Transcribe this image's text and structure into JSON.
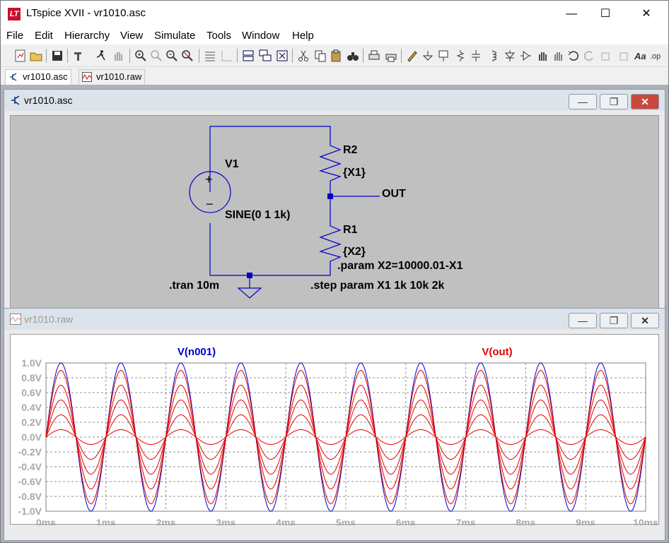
{
  "app": {
    "title": "LTspice XVII - vr1010.asc",
    "icon_name": "ltspice-logo-icon",
    "icon_text": "LT",
    "minimize": "—",
    "maximize": "☐",
    "close": "✕"
  },
  "menu": [
    "File",
    "Edit",
    "Hierarchy",
    "View",
    "Simulate",
    "Tools",
    "Window",
    "Help"
  ],
  "tabs": [
    {
      "label": "vr1010.asc",
      "icon": "schematic-icon",
      "active": true
    },
    {
      "label": "vr1010.raw",
      "icon": "waveform-icon",
      "active": false
    }
  ],
  "schematic": {
    "title": "vr1010.asc",
    "labels": {
      "v1": "V1",
      "v1_value": "SINE(0 1 1k)",
      "r2": "R2",
      "r2_value": "{X1}",
      "r1": "R1",
      "r1_value": "{X2}",
      "out": "OUT",
      "tran": ".tran 10m",
      "param": ".param X2=10000.01-X1",
      "step": ".step param X1 1k 10k 2k"
    },
    "colors": {
      "wire": "#0000c8",
      "background": "#c0c0c0"
    }
  },
  "waveform": {
    "title": "vr1010.raw",
    "trace_labels": {
      "vin": "V(n001)",
      "vout": "V(out)"
    },
    "colors": {
      "vin": "#0000c8",
      "vout": "#e00000",
      "grid": "#808080",
      "axis_text": "#a0a0a0"
    }
  },
  "chart_data": {
    "type": "line",
    "x_unit": "ms",
    "xlim": [
      0,
      10
    ],
    "ylim": [
      -1.0,
      1.0
    ],
    "x_ticks": [
      "0ms",
      "1ms",
      "2ms",
      "3ms",
      "4ms",
      "5ms",
      "6ms",
      "7ms",
      "8ms",
      "9ms",
      "10ms"
    ],
    "y_ticks": [
      "1.0V",
      "0.8V",
      "0.6V",
      "0.4V",
      "0.2V",
      "0.0V",
      "-0.2V",
      "-0.4V",
      "-0.6V",
      "-0.8V",
      "-1.0V"
    ],
    "grid": true,
    "frequency_khz": 1,
    "series": [
      {
        "name": "V(n001)",
        "amplitude": 1.0,
        "color": "#0000c8"
      },
      {
        "name": "V(out)",
        "amplitude": 0.9,
        "color": "#e00000"
      },
      {
        "name": "V(out)",
        "amplitude": 0.7,
        "color": "#e00000"
      },
      {
        "name": "V(out)",
        "amplitude": 0.5,
        "color": "#e00000"
      },
      {
        "name": "V(out)",
        "amplitude": 0.3,
        "color": "#e00000"
      },
      {
        "name": "V(out)",
        "amplitude": 0.1,
        "color": "#e00000"
      }
    ]
  }
}
